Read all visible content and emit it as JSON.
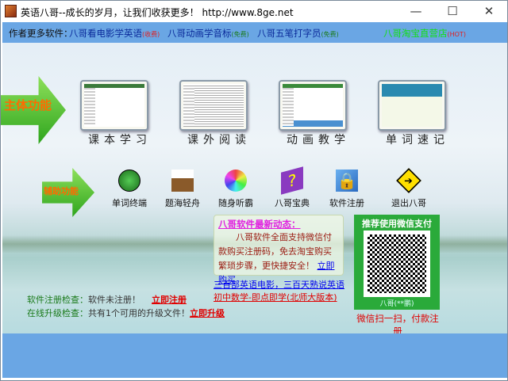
{
  "window": {
    "title": "英语八哥--成长的岁月，让我们收获更多！ http://www.8ge.net",
    "minimize": "—",
    "maximize": "☐",
    "close": "✕"
  },
  "menubar": {
    "label": "作者更多软件：",
    "items": [
      {
        "name": "八哥看电影学英语",
        "tag": "(收费)"
      },
      {
        "name": "八哥动画学音标",
        "tag": "(免费)"
      },
      {
        "name": "八哥五笔打字员",
        "tag": "(免费)"
      },
      {
        "name": "八哥淘宝直营店",
        "tag": "(HOT)"
      }
    ]
  },
  "main": {
    "label": "主体功能",
    "items": [
      "课本学习",
      "课外阅读",
      "动画教学",
      "单词速记"
    ]
  },
  "aux": {
    "label": "辅助功能",
    "items": [
      {
        "label": "单词终端",
        "icon": "ladybug-icon"
      },
      {
        "label": "题海轻舟",
        "icon": "boat-icon"
      },
      {
        "label": "随身听霸",
        "icon": "cd-icon"
      },
      {
        "label": "八哥宝典",
        "icon": "book-icon"
      },
      {
        "label": "软件注册",
        "icon": "lock-icon"
      },
      {
        "label": "退出八哥",
        "icon": "exit-sign-icon"
      }
    ]
  },
  "news": {
    "heading": "八哥软件最新动态：",
    "body": "八哥软件全面支持微信付款购买注册码，免去淘宝购买繁琐步骤，更快捷安全！",
    "buy_link": "立即购买"
  },
  "links": [
    "三百部英语电影，三百天熟说英语",
    "初中数学-即点即学(北师大版本)"
  ],
  "wechat": {
    "title": "推荐使用微信支付",
    "footer": "八哥(**鹏)",
    "caption": "微信扫一扫，付款注册"
  },
  "status": {
    "reg_label": "软件注册检查：",
    "reg_value": "软件未注册！",
    "reg_link": "立即注册",
    "upd_label": "在线升级检查：",
    "upd_value": "共有1个可用的升级文件！",
    "upd_link": "立即升级"
  }
}
